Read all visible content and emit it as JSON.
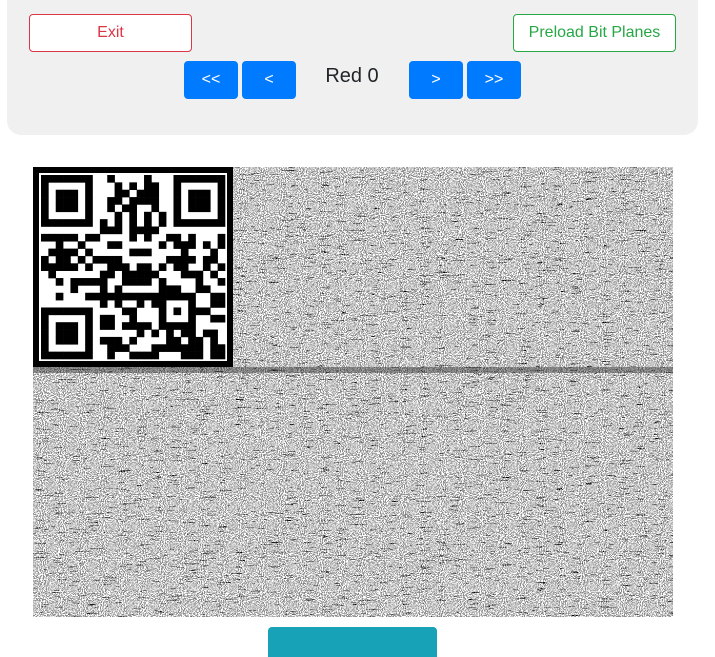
{
  "toolbar": {
    "exit_label": "Exit",
    "preload_label": "Preload Bit Planes",
    "first_label": "<<",
    "prev_label": "<",
    "next_label": ">",
    "last_label": ">>",
    "current_plane": "Red 0"
  },
  "image_view": {
    "content": "bit-plane noise with embedded QR code",
    "qr_code": "qr-code"
  },
  "bottom": {
    "button_label": ""
  },
  "colors": {
    "danger": "#dc3545",
    "success": "#28a745",
    "primary": "#007bff",
    "info": "#17a2b8",
    "panel": "#f0f0f0"
  }
}
